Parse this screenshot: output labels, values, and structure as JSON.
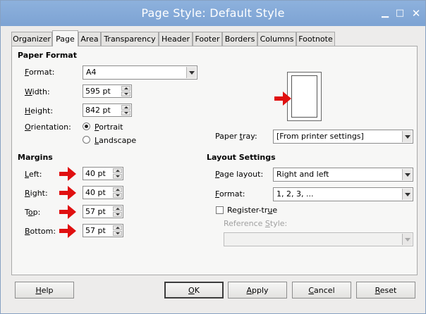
{
  "window": {
    "title": "Page Style: Default Style"
  },
  "tabs": [
    {
      "label": "Organizer"
    },
    {
      "label": "Page"
    },
    {
      "label": "Area"
    },
    {
      "label": "Transparency"
    },
    {
      "label": "Header"
    },
    {
      "label": "Footer"
    },
    {
      "label": "Borders"
    },
    {
      "label": "Columns"
    },
    {
      "label": "Footnote"
    }
  ],
  "paper_format": {
    "heading": "Paper Format",
    "format_label_u": "F",
    "format_label_rest": "ormat:",
    "format_value": "A4",
    "width_label_u": "W",
    "width_label_rest": "idth:",
    "width_value": "595 pt",
    "height_label_u": "H",
    "height_label_rest": "eight:",
    "height_value": "842 pt",
    "orientation_label_u": "O",
    "orientation_label_rest": "rientation:",
    "portrait_u": "P",
    "portrait_rest": "ortrait",
    "landscape_u": "L",
    "landscape_rest": "andscape",
    "orientation_selected": "Portrait",
    "paper_tray_label_pre": "Paper ",
    "paper_tray_label_u": "t",
    "paper_tray_label_rest": "ray:",
    "paper_tray_value": "[From printer settings]"
  },
  "margins": {
    "heading": "Margins",
    "left_u": "L",
    "left_rest": "eft:",
    "left_value": "40 pt",
    "right_u": "R",
    "right_rest": "ight:",
    "right_value": "40 pt",
    "top_pre": "T",
    "top_u": "o",
    "top_rest": "p:",
    "top_value": "57 pt",
    "bottom_u": "B",
    "bottom_rest": "ottom:",
    "bottom_value": "57 pt"
  },
  "layout": {
    "heading": "Layout Settings",
    "page_layout_u": "P",
    "page_layout_rest": "age layout:",
    "page_layout_value": "Right and left",
    "format_u": "F",
    "format_rest": "ormat:",
    "format_value": "1, 2, 3, ...",
    "register_pre": "Register-tr",
    "register_u": "u",
    "register_rest": "e",
    "reference_pre": "Reference ",
    "reference_u": "S",
    "reference_rest": "tyle:",
    "reference_value": ""
  },
  "buttons": {
    "help_u": "H",
    "help_rest": "elp",
    "ok_u": "O",
    "ok_rest": "K",
    "apply_u": "A",
    "apply_rest": "pply",
    "cancel_u": "C",
    "cancel_rest": "ancel",
    "reset_u": "R",
    "reset_rest": "eset"
  },
  "colors": {
    "titlebar": "#7da3d3",
    "arrow": "#e01010"
  }
}
